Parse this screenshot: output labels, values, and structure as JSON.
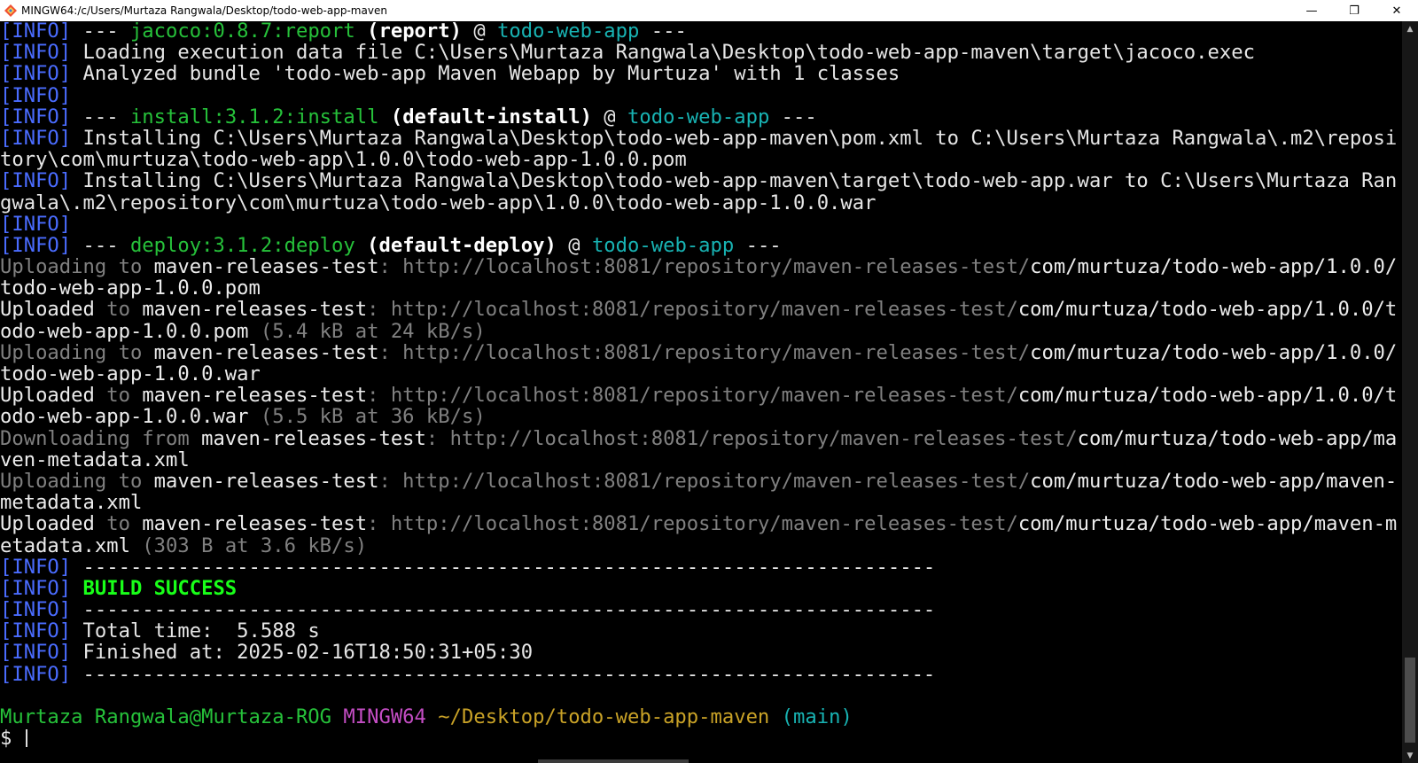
{
  "window": {
    "title": "MINGW64:/c/Users/Murtaza Rangwala/Desktop/todo-web-app-maven",
    "minimize": "—",
    "maximize": "❐",
    "close": "✕"
  },
  "colors": {
    "info": "#4a6cff",
    "plugin": "#26c13a",
    "project": "#18b3b3",
    "muted": "#808080",
    "success": "#19ff19",
    "host": "#c44dc4",
    "path": "#c9a227"
  },
  "lines": [
    [
      {
        "t": "[INFO]",
        "c": "info"
      },
      {
        "t": " --- "
      },
      {
        "t": "jacoco:0.8.7:report",
        "c": "green"
      },
      {
        "t": " (report)",
        "c": "bold"
      },
      {
        "t": " @ "
      },
      {
        "t": "todo-web-app",
        "c": "cyan"
      },
      {
        "t": " ---"
      }
    ],
    [
      {
        "t": "[INFO]",
        "c": "info"
      },
      {
        "t": " Loading execution data file C:\\Users\\Murtaza Rangwala\\Desktop\\todo-web-app-maven\\target\\jacoco.exec"
      }
    ],
    [
      {
        "t": "[INFO]",
        "c": "info"
      },
      {
        "t": " Analyzed bundle 'todo-web-app Maven Webapp by Murtuza' with 1 classes"
      }
    ],
    [
      {
        "t": "[INFO]",
        "c": "info"
      }
    ],
    [
      {
        "t": "[INFO]",
        "c": "info"
      },
      {
        "t": " --- "
      },
      {
        "t": "install:3.1.2:install",
        "c": "green"
      },
      {
        "t": " (default-install)",
        "c": "bold"
      },
      {
        "t": " @ "
      },
      {
        "t": "todo-web-app",
        "c": "cyan"
      },
      {
        "t": " ---"
      }
    ],
    [
      {
        "t": "[INFO]",
        "c": "info"
      },
      {
        "t": " Installing C:\\Users\\Murtaza Rangwala\\Desktop\\todo-web-app-maven\\pom.xml to C:\\Users\\Murtaza Rangwala\\.m2\\reposi"
      }
    ],
    [
      {
        "t": "tory\\com\\murtuza\\todo-web-app\\1.0.0\\todo-web-app-1.0.0.pom"
      }
    ],
    [
      {
        "t": "[INFO]",
        "c": "info"
      },
      {
        "t": " Installing C:\\Users\\Murtaza Rangwala\\Desktop\\todo-web-app-maven\\target\\todo-web-app.war to C:\\Users\\Murtaza Ran"
      }
    ],
    [
      {
        "t": "gwala\\.m2\\repository\\com\\murtuza\\todo-web-app\\1.0.0\\todo-web-app-1.0.0.war"
      }
    ],
    [
      {
        "t": "[INFO]",
        "c": "info"
      }
    ],
    [
      {
        "t": "[INFO]",
        "c": "info"
      },
      {
        "t": " --- "
      },
      {
        "t": "deploy:3.1.2:deploy",
        "c": "green"
      },
      {
        "t": " (default-deploy)",
        "c": "bold"
      },
      {
        "t": " @ "
      },
      {
        "t": "todo-web-app",
        "c": "cyan"
      },
      {
        "t": " ---"
      }
    ],
    [
      {
        "t": "Uploading to ",
        "c": "gray"
      },
      {
        "t": "maven-releases-test",
        "c": "white"
      },
      {
        "t": ": http://localhost:8081/repository/maven-releases-test/",
        "c": "gray"
      },
      {
        "t": "com/murtuza/todo-web-app/1.0.0/",
        "c": "white"
      }
    ],
    [
      {
        "t": "todo-web-app-1.0.0.pom",
        "c": "white"
      }
    ],
    [
      {
        "t": "Uploaded",
        "c": "white"
      },
      {
        "t": " to ",
        "c": "gray"
      },
      {
        "t": "maven-releases-test",
        "c": "white"
      },
      {
        "t": ": http://localhost:8081/repository/maven-releases-test/",
        "c": "gray"
      },
      {
        "t": "com/murtuza/todo-web-app/1.0.0/t",
        "c": "white"
      }
    ],
    [
      {
        "t": "odo-web-app-1.0.0.pom",
        "c": "white"
      },
      {
        "t": " (5.4 kB at 24 kB/s)",
        "c": "gray"
      }
    ],
    [
      {
        "t": "Uploading to ",
        "c": "gray"
      },
      {
        "t": "maven-releases-test",
        "c": "white"
      },
      {
        "t": ": http://localhost:8081/repository/maven-releases-test/",
        "c": "gray"
      },
      {
        "t": "com/murtuza/todo-web-app/1.0.0/",
        "c": "white"
      }
    ],
    [
      {
        "t": "todo-web-app-1.0.0.war",
        "c": "white"
      }
    ],
    [
      {
        "t": "Uploaded",
        "c": "white"
      },
      {
        "t": " to ",
        "c": "gray"
      },
      {
        "t": "maven-releases-test",
        "c": "white"
      },
      {
        "t": ": http://localhost:8081/repository/maven-releases-test/",
        "c": "gray"
      },
      {
        "t": "com/murtuza/todo-web-app/1.0.0/t",
        "c": "white"
      }
    ],
    [
      {
        "t": "odo-web-app-1.0.0.war",
        "c": "white"
      },
      {
        "t": " (5.5 kB at 36 kB/s)",
        "c": "gray"
      }
    ],
    [
      {
        "t": "Downloading from ",
        "c": "gray"
      },
      {
        "t": "maven-releases-test",
        "c": "white"
      },
      {
        "t": ": http://localhost:8081/repository/maven-releases-test/",
        "c": "gray"
      },
      {
        "t": "com/murtuza/todo-web-app/ma",
        "c": "white"
      }
    ],
    [
      {
        "t": "ven-metadata.xml",
        "c": "white"
      }
    ],
    [
      {
        "t": "Uploading to ",
        "c": "gray"
      },
      {
        "t": "maven-releases-test",
        "c": "white"
      },
      {
        "t": ": http://localhost:8081/repository/maven-releases-test/",
        "c": "gray"
      },
      {
        "t": "com/murtuza/todo-web-app/maven-",
        "c": "white"
      }
    ],
    [
      {
        "t": "metadata.xml",
        "c": "white"
      }
    ],
    [
      {
        "t": "Uploaded",
        "c": "white"
      },
      {
        "t": " to ",
        "c": "gray"
      },
      {
        "t": "maven-releases-test",
        "c": "white"
      },
      {
        "t": ": http://localhost:8081/repository/maven-releases-test/",
        "c": "gray"
      },
      {
        "t": "com/murtuza/todo-web-app/maven-m",
        "c": "white"
      }
    ],
    [
      {
        "t": "etadata.xml",
        "c": "white"
      },
      {
        "t": " (303 B at 3.6 kB/s)",
        "c": "gray"
      }
    ],
    [
      {
        "t": "[INFO]",
        "c": "info"
      },
      {
        "t": " ------------------------------------------------------------------------"
      }
    ],
    [
      {
        "t": "[INFO]",
        "c": "info"
      },
      {
        "t": " "
      },
      {
        "t": "BUILD SUCCESS",
        "c": "bright-green"
      }
    ],
    [
      {
        "t": "[INFO]",
        "c": "info"
      },
      {
        "t": " ------------------------------------------------------------------------"
      }
    ],
    [
      {
        "t": "[INFO]",
        "c": "info"
      },
      {
        "t": " Total time:  5.588 s"
      }
    ],
    [
      {
        "t": "[INFO]",
        "c": "info"
      },
      {
        "t": " Finished at: 2025-02-16T18:50:31+05:30"
      }
    ],
    [
      {
        "t": "[INFO]",
        "c": "info"
      },
      {
        "t": " ------------------------------------------------------------------------"
      }
    ],
    [],
    [
      {
        "t": "Murtaza Rangwala@Murtaza-ROG",
        "c": "green"
      },
      {
        "t": " "
      },
      {
        "t": "MINGW64",
        "c": "magenta"
      },
      {
        "t": " "
      },
      {
        "t": "~/Desktop/todo-web-app-maven",
        "c": "yellow"
      },
      {
        "t": " "
      },
      {
        "t": "(main)",
        "c": "cyan"
      }
    ]
  ],
  "prompt": {
    "symbol": "$ "
  }
}
